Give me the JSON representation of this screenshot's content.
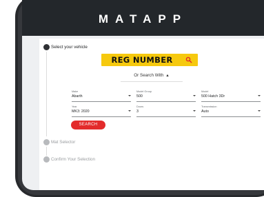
{
  "app": {
    "logo_text": "MATAPP"
  },
  "steps": [
    {
      "label": "Select your vehicle",
      "state": "active"
    },
    {
      "label": "Mat Selector",
      "state": "inactive"
    },
    {
      "label": "Confirm Your Selection",
      "state": "inactive"
    }
  ],
  "registration": {
    "value": "REG NUMBER",
    "icon": "search-icon",
    "background_color": "#f6c90e"
  },
  "or_search": {
    "label": "Or Search With",
    "icon": "chevron-up-icon"
  },
  "fields": {
    "make": {
      "label": "Make",
      "value": "Abarth"
    },
    "model_group": {
      "label": "Model Group",
      "value": "500"
    },
    "model": {
      "label": "Model",
      "value": "500 Hatch 3Dr"
    },
    "year": {
      "label": "Year",
      "value": "MK3: 2020"
    },
    "doors": {
      "label": "Doors",
      "value": "3"
    },
    "transmission": {
      "label": "Transmission",
      "value": "Auto"
    }
  },
  "search_button": {
    "label": "SEARCH",
    "color": "#e32b2b"
  }
}
